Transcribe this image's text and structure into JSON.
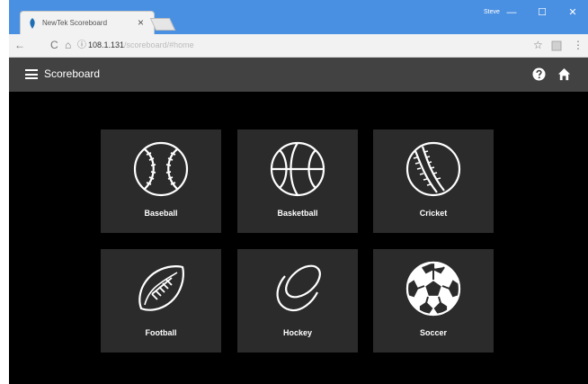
{
  "browser": {
    "tab_title": "NewTek Scoreboard",
    "tab_close": "×",
    "user_name": "Steve",
    "minimize": "—",
    "maximize": "☐",
    "close": "✕",
    "url_host": "108.1.131",
    "url_path": "/scoreboard/#home",
    "back": "←",
    "reload": "C",
    "home": "⌂",
    "info": "ⓘ",
    "star": "☆",
    "menu": "⋮"
  },
  "app": {
    "title": "Scoreboard"
  },
  "sports": [
    {
      "label": "Baseball",
      "icon": "baseball-icon"
    },
    {
      "label": "Basketball",
      "icon": "basketball-icon"
    },
    {
      "label": "Cricket",
      "icon": "cricket-icon"
    },
    {
      "label": "Football",
      "icon": "football-icon"
    },
    {
      "label": "Hockey",
      "icon": "hockey-puck-icon"
    },
    {
      "label": "Soccer",
      "icon": "soccer-icon"
    }
  ],
  "colors": {
    "titlebar": "#4a90e2",
    "appbar": "#424242",
    "tile": "#2b2b2b",
    "background": "#000000"
  }
}
